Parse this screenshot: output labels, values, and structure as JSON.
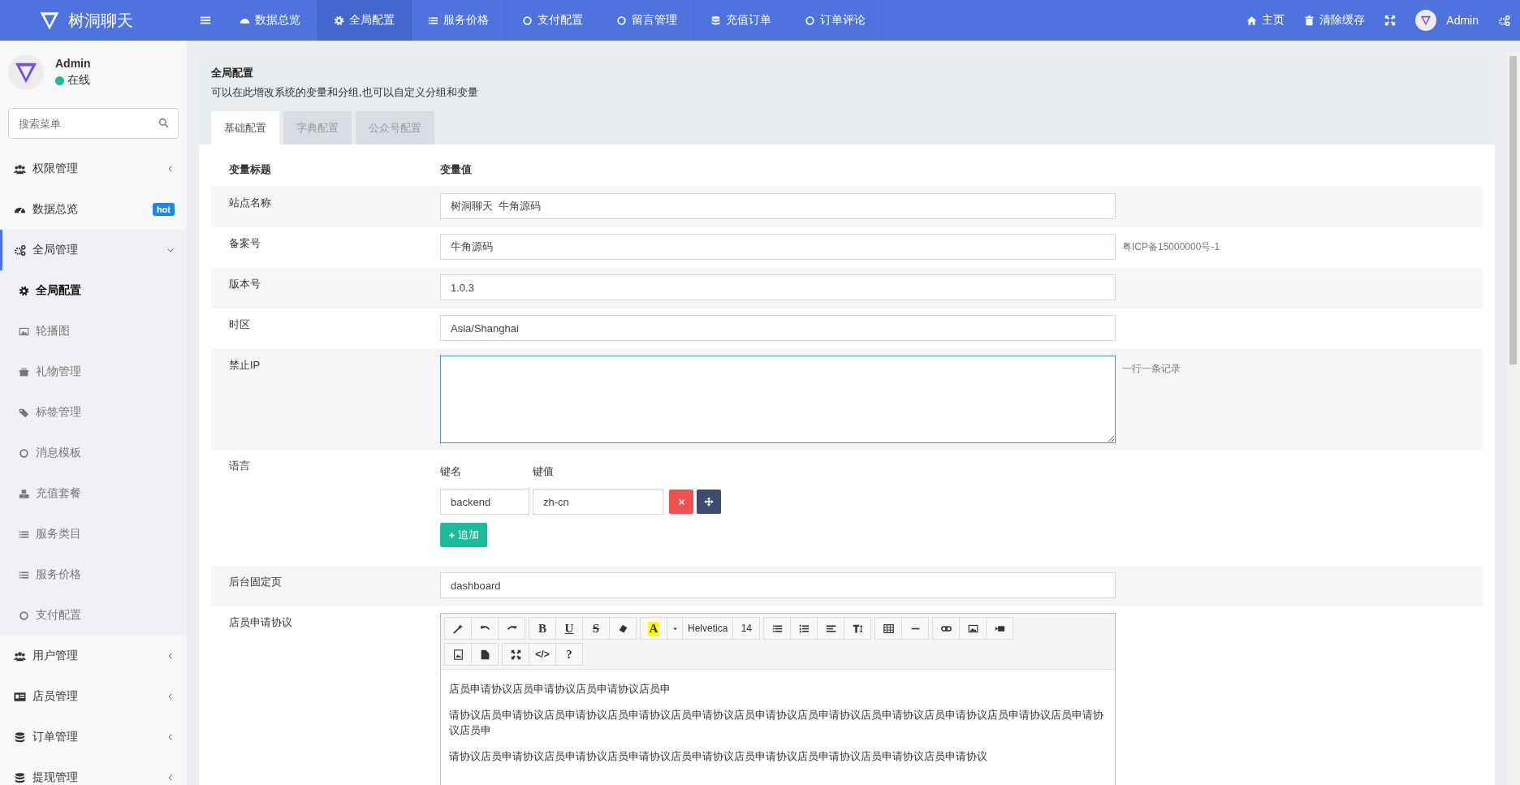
{
  "brand": {
    "name": "树洞聊天"
  },
  "top_nav": [
    {
      "label": "数据总览",
      "selected": false
    },
    {
      "label": "全局配置",
      "selected": true
    },
    {
      "label": "服务价格",
      "selected": false
    },
    {
      "label": "支付配置",
      "selected": false
    },
    {
      "label": "留言管理",
      "selected": false
    },
    {
      "label": "充值订单",
      "selected": false
    },
    {
      "label": "订单评论",
      "selected": false
    }
  ],
  "top_right": {
    "home": "主页",
    "clear_cache": "清除缓存",
    "user": "Admin"
  },
  "sidebar": {
    "user": {
      "name": "Admin",
      "status": "在线"
    },
    "search": {
      "placeholder": "搜索菜单"
    },
    "items": [
      {
        "label": "权限管理",
        "expanded": false
      },
      {
        "label": "数据总览",
        "badge": "hot"
      },
      {
        "label": "全局管理",
        "expanded": true,
        "children": [
          {
            "label": "全局配置",
            "selected": true
          },
          {
            "label": "轮播图",
            "selected": false
          },
          {
            "label": "礼物管理",
            "selected": false
          },
          {
            "label": "标签管理",
            "selected": false
          },
          {
            "label": "消息模板",
            "selected": false
          },
          {
            "label": "充值套餐",
            "selected": false
          },
          {
            "label": "服务类目",
            "selected": false
          },
          {
            "label": "服务价格",
            "selected": false
          },
          {
            "label": "支付配置",
            "selected": false
          }
        ]
      },
      {
        "label": "用户管理",
        "expanded": false
      },
      {
        "label": "店员管理",
        "expanded": false
      },
      {
        "label": "订单管理",
        "expanded": false
      },
      {
        "label": "提现管理",
        "expanded": false
      }
    ]
  },
  "page": {
    "title": "全局配置",
    "description": "可以在此增改系统的变量和分组,也可以自定义分组和变量",
    "tabs": [
      {
        "label": "基础配置",
        "selected": true
      },
      {
        "label": "字典配置",
        "selected": false
      },
      {
        "label": "公众号配置",
        "selected": false
      }
    ],
    "columns": [
      "变量标题",
      "变量值"
    ],
    "rows": [
      {
        "kind": "text",
        "label": "站点名称",
        "value": "树洞聊天  牛角源码"
      },
      {
        "kind": "text",
        "label": "备案号",
        "value": "牛角源码",
        "hint": "粤ICP备15000000号-1"
      },
      {
        "kind": "text",
        "label": "版本号",
        "value": "1.0.3"
      },
      {
        "kind": "text",
        "label": "时区",
        "value": "Asia/Shanghai"
      },
      {
        "kind": "textarea",
        "label": "禁止IP",
        "focused": true,
        "hint": "一行一条记录"
      },
      {
        "kind": "keyvalue",
        "label": "语言",
        "key_header": "键名",
        "value_header": "键值",
        "pairs": [
          {
            "key": "backend",
            "value": "zh-cn"
          }
        ],
        "add_button": "追加"
      },
      {
        "kind": "text",
        "label": "后台固定页",
        "value": "dashboard"
      },
      {
        "kind": "editor",
        "label": "店员申请协议",
        "toolbar": [
          [
            [
              {
                "kind": "icon"
              },
              {
                "kind": "icon"
              },
              {
                "kind": "icon"
              }
            ],
            [
              {
                "kind": "bold",
                "label": "B"
              },
              {
                "kind": "underline",
                "label": "U"
              },
              {
                "kind": "strike",
                "label": "S"
              },
              {
                "kind": "icon"
              }
            ],
            [
              {
                "kind": "color",
                "label": "A"
              },
              {
                "kind": "icon"
              },
              {
                "kind": "text",
                "label": "Helvetica"
              },
              {
                "kind": "text",
                "label": "14"
              }
            ],
            [
              {
                "kind": "icon"
              },
              {
                "kind": "icon"
              },
              {
                "kind": "icon"
              },
              {
                "kind": "icon"
              }
            ],
            [
              {
                "kind": "icon"
              },
              {
                "kind": "icon"
              }
            ],
            [
              {
                "kind": "icon"
              },
              {
                "kind": "icon"
              },
              {
                "kind": "icon"
              }
            ]
          ],
          [
            [
              {
                "kind": "icon"
              },
              {
                "kind": "icon"
              }
            ],
            [
              {
                "kind": "icon"
              },
              {
                "kind": "code",
                "label": "</>"
              },
              {
                "kind": "bold",
                "label": "?"
              }
            ]
          ]
        ],
        "paragraphs": [
          "店员申请协议店员申请协议店员申请协议店员申",
          "请协议店员申请协议店员申请协议店员申请协议店员申请协议店员申请协议店员申请协议店员申请协议店员申请协议店员申请协议店员申请协议店员申",
          "请协议店员申请协议店员申请协议店员申请协议店员申请协议店员申请协议店员申请协议店员申请协议店员申请协议"
        ]
      }
    ]
  }
}
